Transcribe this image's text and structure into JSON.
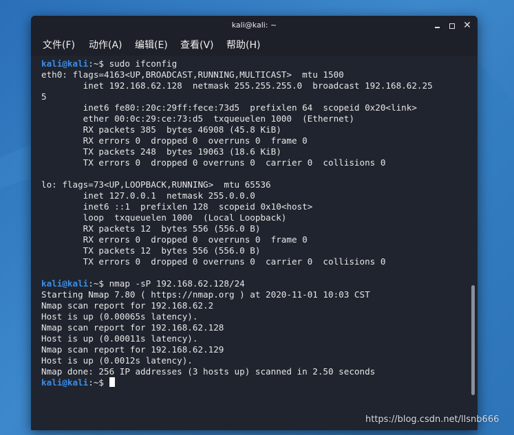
{
  "window": {
    "title": "kali@kali: ~"
  },
  "menu": [
    {
      "label": "文件(F)"
    },
    {
      "label": "动作(A)"
    },
    {
      "label": "编辑(E)"
    },
    {
      "label": "查看(V)"
    },
    {
      "label": "帮助(H)"
    }
  ],
  "prompt": {
    "user": "kali@kali",
    "path_symbol": ":~$ "
  },
  "terminal_lines": [
    {
      "type": "prompt",
      "cmd": "sudo ifconfig"
    },
    {
      "type": "out",
      "text": "eth0: flags=4163<UP,BROADCAST,RUNNING,MULTICAST>  mtu 1500"
    },
    {
      "type": "out",
      "text": "        inet 192.168.62.128  netmask 255.255.255.0  broadcast 192.168.62.25"
    },
    {
      "type": "out",
      "text": "5"
    },
    {
      "type": "out",
      "text": "        inet6 fe80::20c:29ff:fece:73d5  prefixlen 64  scopeid 0x20<link>"
    },
    {
      "type": "out",
      "text": "        ether 00:0c:29:ce:73:d5  txqueuelen 1000  (Ethernet)"
    },
    {
      "type": "out",
      "text": "        RX packets 385  bytes 46908 (45.8 KiB)"
    },
    {
      "type": "out",
      "text": "        RX errors 0  dropped 0  overruns 0  frame 0"
    },
    {
      "type": "out",
      "text": "        TX packets 248  bytes 19063 (18.6 KiB)"
    },
    {
      "type": "out",
      "text": "        TX errors 0  dropped 0 overruns 0  carrier 0  collisions 0"
    },
    {
      "type": "out",
      "text": ""
    },
    {
      "type": "out",
      "text": "lo: flags=73<UP,LOOPBACK,RUNNING>  mtu 65536"
    },
    {
      "type": "out",
      "text": "        inet 127.0.0.1  netmask 255.0.0.0"
    },
    {
      "type": "out",
      "text": "        inet6 ::1  prefixlen 128  scopeid 0x10<host>"
    },
    {
      "type": "out",
      "text": "        loop  txqueuelen 1000  (Local Loopback)"
    },
    {
      "type": "out",
      "text": "        RX packets 12  bytes 556 (556.0 B)"
    },
    {
      "type": "out",
      "text": "        RX errors 0  dropped 0  overruns 0  frame 0"
    },
    {
      "type": "out",
      "text": "        TX packets 12  bytes 556 (556.0 B)"
    },
    {
      "type": "out",
      "text": "        TX errors 0  dropped 0 overruns 0  carrier 0  collisions 0"
    },
    {
      "type": "out",
      "text": ""
    },
    {
      "type": "prompt",
      "cmd": "nmap -sP 192.168.62.128/24"
    },
    {
      "type": "out",
      "text": "Starting Nmap 7.80 ( https://nmap.org ) at 2020-11-01 10:03 CST"
    },
    {
      "type": "out",
      "text": "Nmap scan report for 192.168.62.2"
    },
    {
      "type": "out",
      "text": "Host is up (0.00065s latency)."
    },
    {
      "type": "out",
      "text": "Nmap scan report for 192.168.62.128"
    },
    {
      "type": "out",
      "text": "Host is up (0.00011s latency)."
    },
    {
      "type": "out",
      "text": "Nmap scan report for 192.168.62.129"
    },
    {
      "type": "out",
      "text": "Host is up (0.0012s latency)."
    },
    {
      "type": "out",
      "text": "Nmap done: 256 IP addresses (3 hosts up) scanned in 2.50 seconds"
    },
    {
      "type": "prompt",
      "cmd": "",
      "cursor": true
    }
  ],
  "watermark": "https://blog.csdn.net/llsnb666",
  "colors": {
    "prompt_user": "#3b8eea",
    "terminal_bg": "#20242e",
    "text": "#e6e6e6"
  },
  "icons": {
    "minimize": "minimize-icon",
    "maximize": "maximize-icon",
    "close": "close-icon"
  }
}
